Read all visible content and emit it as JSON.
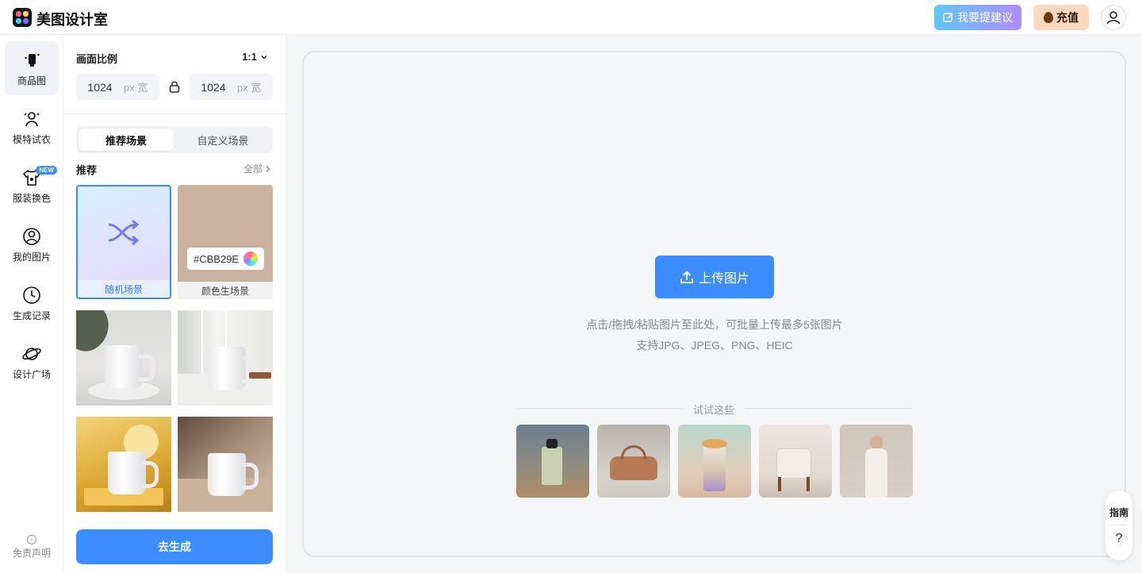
{
  "app": {
    "brand": "美图设计室"
  },
  "header": {
    "suggest_label": "我要提建议",
    "recharge_label": "充值"
  },
  "nav": {
    "items": [
      {
        "label": "商品图",
        "icon": "product-icon"
      },
      {
        "label": "模特试衣",
        "icon": "model-icon"
      },
      {
        "label": "服装换色",
        "icon": "shirt-icon",
        "badge": "NEW"
      },
      {
        "label": "我的图片",
        "icon": "user-circle-icon"
      },
      {
        "label": "生成记录",
        "icon": "clock-icon"
      },
      {
        "label": "设计广场",
        "icon": "planet-icon"
      }
    ],
    "disclaimer": "免责声明"
  },
  "panel": {
    "ratio_title": "画面比例",
    "ratio_value": "1:1",
    "width_value": "1024",
    "height_value": "1024",
    "unit_label": "px 宽",
    "tabs": [
      "推荐场景",
      "自定义场景"
    ],
    "recommend_title": "推荐",
    "all_label": "全部",
    "random_label": "随机场景",
    "color_label": "颜色生场景",
    "color_value": "#CBB29E",
    "generate_label": "去生成"
  },
  "main": {
    "upload_label": "上传图片",
    "hint_line1": "点击/拖拽/粘贴图片至此处，可批量上传最多5张图片",
    "hint_line2": "支持JPG、JPEG、PNG、HEIC",
    "try_label": "试试这些"
  },
  "guide": {
    "label": "指南",
    "help": "?"
  },
  "colors": {
    "accent": "#3a8cff",
    "selected_scene": "#CBB29E"
  }
}
